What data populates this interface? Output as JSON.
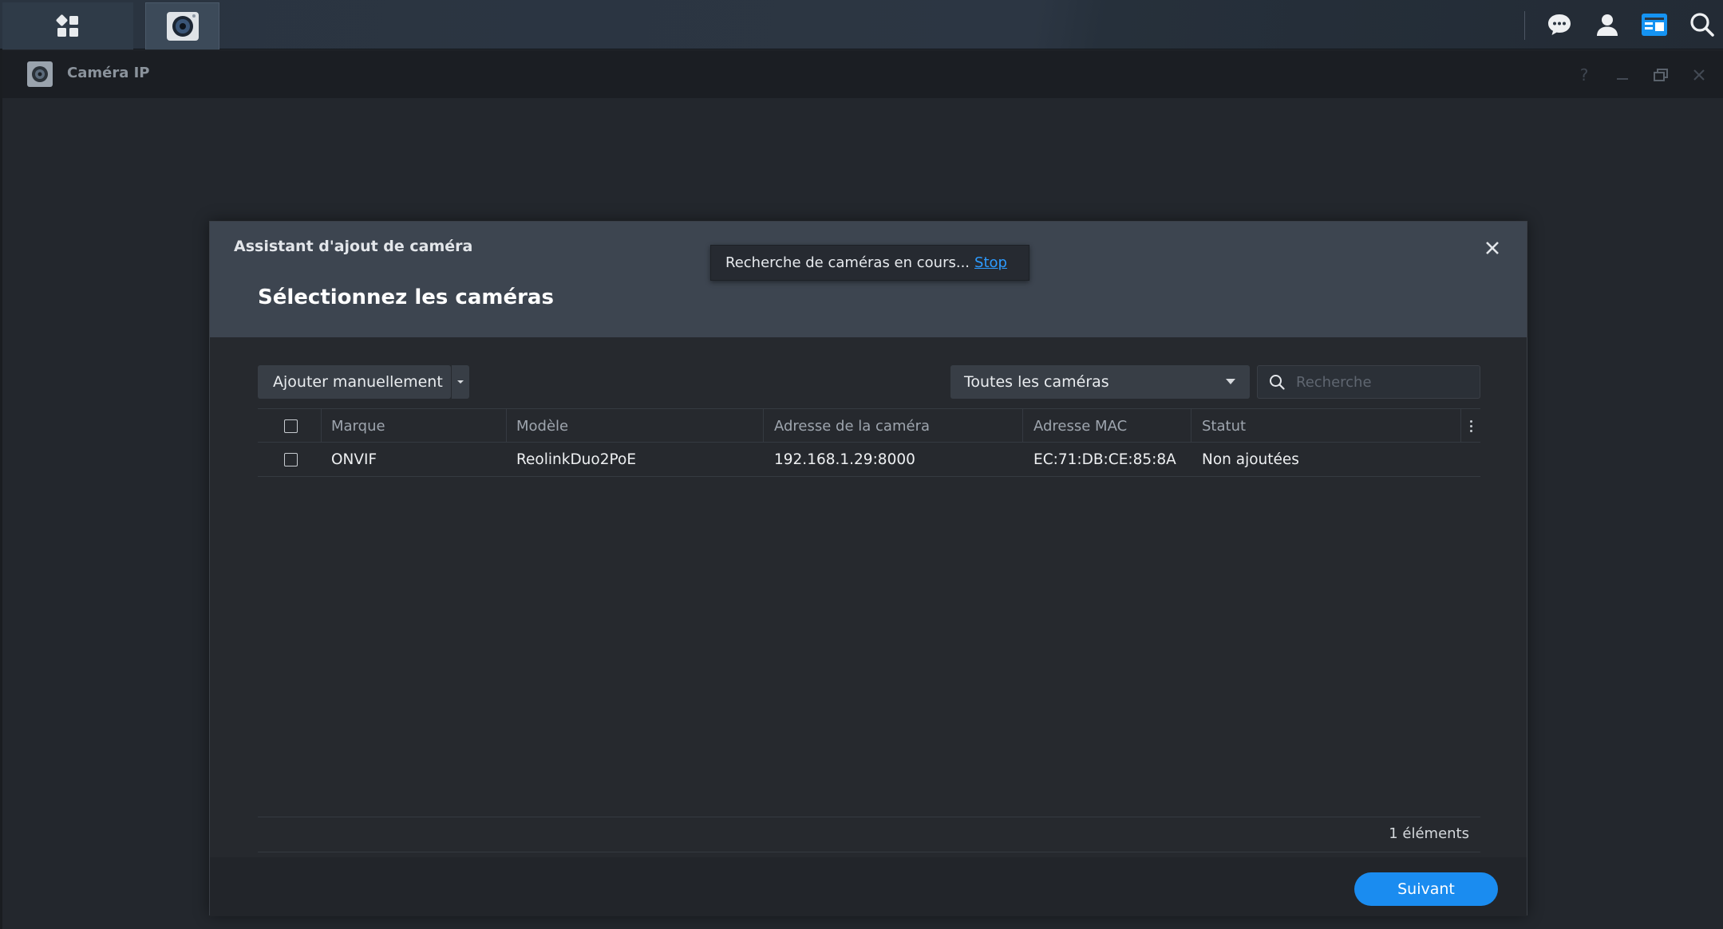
{
  "taskbar": {
    "main_menu_icon": "grid-icon",
    "app_icon": "camera-icon",
    "right_icons": [
      "chat-icon",
      "user-icon",
      "widgets-icon",
      "search-icon"
    ]
  },
  "window": {
    "title": "Caméra IP",
    "controls": [
      "help-icon",
      "minimize-icon",
      "restore-icon",
      "close-icon"
    ],
    "help_glyph": "?"
  },
  "dialog": {
    "small_title": "Assistant d'ajout de caméra",
    "title": "Sélectionnez les caméras",
    "toast": {
      "text": "Recherche de caméras en cours...",
      "link": "Stop"
    },
    "toolbar": {
      "add_manual_label": "Ajouter manuellement",
      "filter_value": "Toutes les caméras",
      "search_placeholder": "Recherche"
    },
    "table": {
      "columns": [
        "Marque",
        "Modèle",
        "Adresse de la caméra",
        "Adresse MAC",
        "Statut"
      ],
      "rows": [
        {
          "brand": "ONVIF",
          "model": "ReolinkDuo2PoE",
          "address": "192.168.1.29:8000",
          "mac": "EC:71:DB:CE:85:8A",
          "status": "Non ajoutées"
        }
      ]
    },
    "count_label": "1 éléments",
    "next_label": "Suivant"
  },
  "colors": {
    "accent": "#1a8cf0",
    "link": "#2d9bff",
    "dialog_header": "#3d4550",
    "background": "#23272d"
  }
}
